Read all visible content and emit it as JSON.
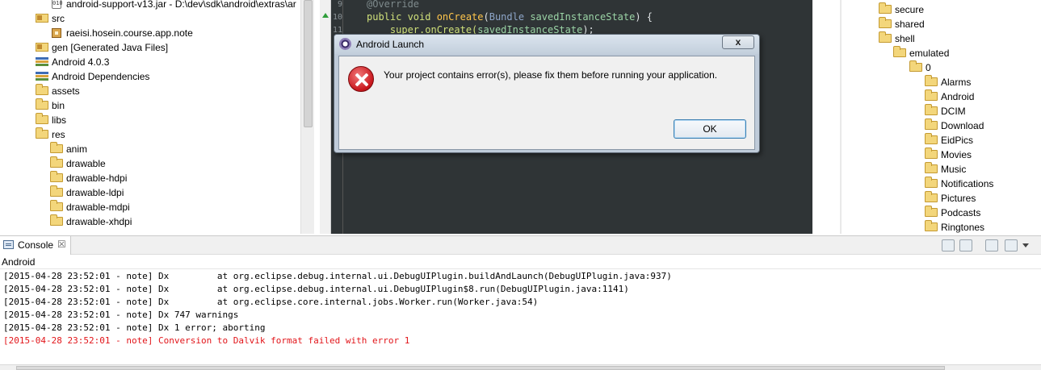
{
  "package_explorer": {
    "items": [
      {
        "label": "android-support-v13.jar - D:\\dev\\sdk\\android\\extras\\ar",
        "icon": "jar-icon",
        "indent": 3
      },
      {
        "label": "src",
        "icon": "source-folder-icon",
        "indent": 2
      },
      {
        "label": "raeisi.hosein.course.app.note",
        "icon": "package-icon",
        "indent": 3
      },
      {
        "label": "gen [Generated Java Files]",
        "icon": "source-folder-icon",
        "indent": 2
      },
      {
        "label": "Android 4.0.3",
        "icon": "library-icon",
        "indent": 2
      },
      {
        "label": "Android Dependencies",
        "icon": "library-icon",
        "indent": 2
      },
      {
        "label": "assets",
        "icon": "folder-icon",
        "indent": 2
      },
      {
        "label": "bin",
        "icon": "folder-icon",
        "indent": 2
      },
      {
        "label": "libs",
        "icon": "folder-icon",
        "indent": 2
      },
      {
        "label": "res",
        "icon": "folder-open-icon",
        "indent": 2
      },
      {
        "label": "anim",
        "icon": "folder-icon",
        "indent": 3
      },
      {
        "label": "drawable",
        "icon": "folder-icon",
        "indent": 3
      },
      {
        "label": "drawable-hdpi",
        "icon": "folder-icon",
        "indent": 3
      },
      {
        "label": "drawable-ldpi",
        "icon": "folder-icon",
        "indent": 3
      },
      {
        "label": "drawable-mdpi",
        "icon": "folder-icon",
        "indent": 3
      },
      {
        "label": "drawable-xhdpi",
        "icon": "folder-icon",
        "indent": 3
      }
    ]
  },
  "editor": {
    "lines": [
      {
        "num": "9",
        "parts": [
          {
            "t": "@Override",
            "c": "anno"
          }
        ]
      },
      {
        "num": "10",
        "parts": [
          {
            "t": "public void ",
            "c": "kw"
          },
          {
            "t": "onCreate",
            "c": "fn"
          },
          {
            "t": "(",
            "c": "punct"
          },
          {
            "t": "Bundle ",
            "c": "type"
          },
          {
            "t": "savedInstanceState",
            "c": "param"
          },
          {
            "t": ") {",
            "c": "punct"
          }
        ]
      },
      {
        "num": "11",
        "parts": [
          {
            "t": "    super.onCreate(",
            "c": "kw"
          },
          {
            "t": "savedInstanceState",
            "c": "param"
          },
          {
            "t": ");",
            "c": "punct"
          }
        ]
      }
    ]
  },
  "file_explorer": {
    "items": [
      {
        "label": "secure",
        "indent": 0
      },
      {
        "label": "shared",
        "indent": 0
      },
      {
        "label": "shell",
        "indent": 0
      },
      {
        "label": "emulated",
        "indent": 1
      },
      {
        "label": "0",
        "indent": 2
      },
      {
        "label": "Alarms",
        "indent": 3
      },
      {
        "label": "Android",
        "indent": 3
      },
      {
        "label": "DCIM",
        "indent": 3
      },
      {
        "label": "Download",
        "indent": 3
      },
      {
        "label": "EidPics",
        "indent": 3
      },
      {
        "label": "Movies",
        "indent": 3
      },
      {
        "label": "Music",
        "indent": 3
      },
      {
        "label": "Notifications",
        "indent": 3
      },
      {
        "label": "Pictures",
        "indent": 3
      },
      {
        "label": "Podcasts",
        "indent": 3
      },
      {
        "label": "Ringtones",
        "indent": 3
      }
    ]
  },
  "console": {
    "tab_label": "Console",
    "tab_close": "☒",
    "name": "Android",
    "lines": [
      {
        "text": "[2015-04-28 23:52:01 - note] Dx         at org.eclipse.debug.internal.ui.DebugUIPlugin.buildAndLaunch(DebugUIPlugin.java:937)",
        "error": false
      },
      {
        "text": "[2015-04-28 23:52:01 - note] Dx         at org.eclipse.debug.internal.ui.DebugUIPlugin$8.run(DebugUIPlugin.java:1141)",
        "error": false
      },
      {
        "text": "[2015-04-28 23:52:01 - note] Dx         at org.eclipse.core.internal.jobs.Worker.run(Worker.java:54)",
        "error": false
      },
      {
        "text": "[2015-04-28 23:52:01 - note] Dx 747 warnings",
        "error": false
      },
      {
        "text": "[2015-04-28 23:52:01 - note] Dx 1 error; aborting",
        "error": false
      },
      {
        "text": "[2015-04-28 23:52:01 - note] Conversion to Dalvik format failed with error 1",
        "error": true
      }
    ],
    "toolbar_icons": [
      "clear-console-icon",
      "scroll-lock-icon",
      "pin-console-icon",
      "display-console-icon",
      "view-menu-icon"
    ]
  },
  "dialog": {
    "title": "Android Launch",
    "close_label": "x",
    "message": "Your project contains error(s), please fix them before running your application.",
    "ok_label": "OK"
  },
  "colors": {
    "editor_bg": "#2f3436",
    "error_text": "#e2151a",
    "dialog_frame": "#bfcbd9"
  }
}
